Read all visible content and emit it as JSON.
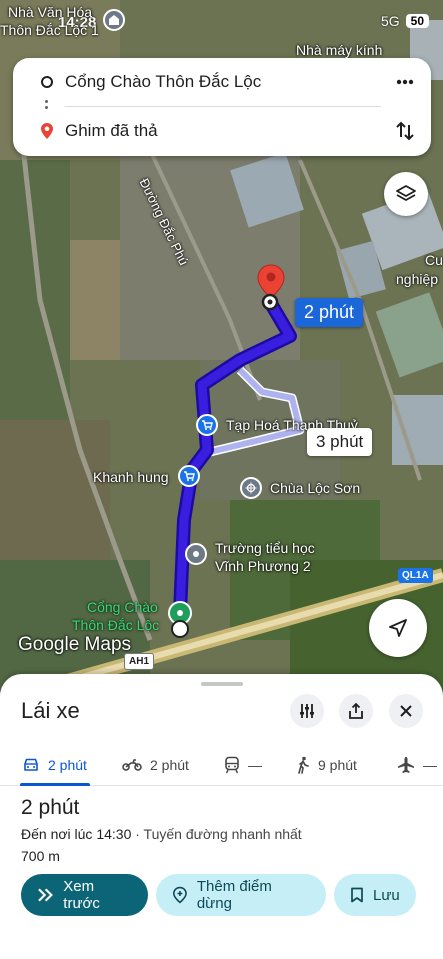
{
  "status_bar": {
    "time": "14:28",
    "network": "5G",
    "battery": "50"
  },
  "search": {
    "origin": "Cổng Chào Thôn Đắc Lộc",
    "destination": "Ghim đã thả",
    "more_icon": "more-vert-icon",
    "swap_icon": "swap-vert-icon"
  },
  "map": {
    "labels": {
      "nha_van_hoa": "Nhà Văn Hóa",
      "nha_van_hoa_2": "Thôn Đắc Lộc 1",
      "nha_may_kinh": "Nhà máy kính",
      "street_dac_phu": "Đường Đắc Phú",
      "cu": "Cu",
      "nghiep": "nghiệp",
      "tap_hoa": "Tạp Hoá Thanh Thuỷ",
      "khanh_hung": "Khanh hung",
      "chua_loc_son": "Chùa Lộc Sơn",
      "truong_1": "Trường tiểu học",
      "truong_2": "Vĩnh Phương 2",
      "cong_chao_1": "Cổng Chào",
      "cong_chao_2": "Thôn Đắc Lộc",
      "ql1a": "QL1A",
      "ah1": "AH1"
    },
    "route_primary_time": "2 phút",
    "route_alt_time": "3 phút",
    "logo": "Google Maps",
    "colors": {
      "route": "#3a1ee0",
      "route_alt": "#b3b6f2",
      "pin": "#ea4335",
      "start": "#1e9e5a"
    }
  },
  "sheet": {
    "title": "Lái xe",
    "tabs": [
      {
        "icon": "car-icon",
        "label": "2 phút",
        "active": true
      },
      {
        "icon": "motorcycle-icon",
        "label": "2 phút"
      },
      {
        "icon": "transit-icon",
        "label": "—"
      },
      {
        "icon": "walk-icon",
        "label": "9 phút"
      },
      {
        "icon": "flight-icon",
        "label": "—"
      }
    ],
    "eta": "2 phút",
    "arrival": "Đến nơi lúc 14:30",
    "route_desc": " · Tuyến đường nhanh nhất",
    "distance": "700 m",
    "buttons": {
      "preview": "Xem trước",
      "add_stop": "Thêm điểm dừng",
      "save": "Lưu"
    }
  }
}
